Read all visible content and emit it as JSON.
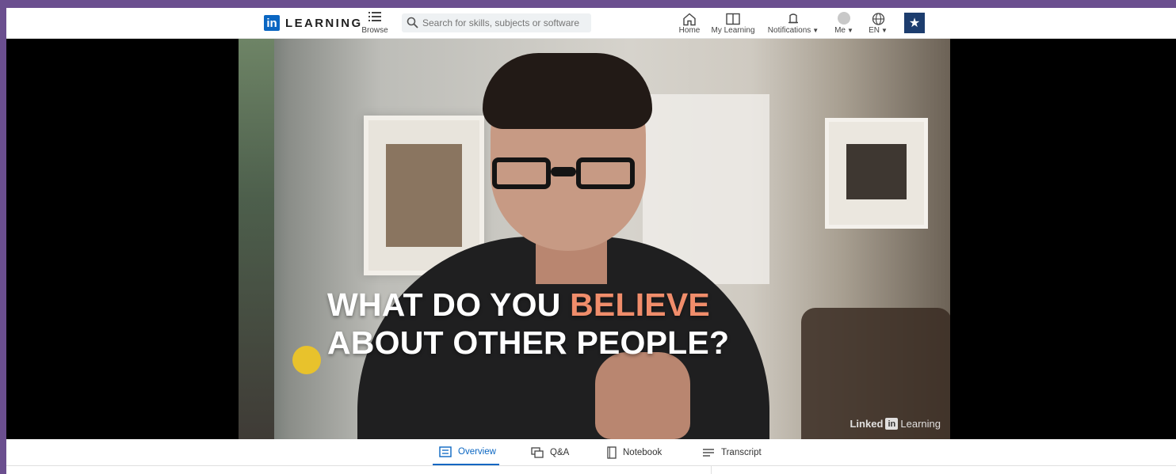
{
  "header": {
    "logo_badge": "in",
    "logo_text": "LEARNING",
    "browse_label": "Browse",
    "search_placeholder": "Search for skills, subjects or software",
    "nav": {
      "home": "Home",
      "my_learning": "My Learning",
      "notifications": "Notifications",
      "me": "Me",
      "language": "EN"
    }
  },
  "video": {
    "caption_line1_prefix": "WHAT DO YOU",
    "caption_line1_highlight": "BELIEVE",
    "caption_line2": "ABOUT OTHER PEOPLE?",
    "watermark_left": "Linked",
    "watermark_badge": "in",
    "watermark_right": "Learning"
  },
  "tabs": [
    {
      "label": "Overview",
      "active": true
    },
    {
      "label": "Q&A",
      "active": false
    },
    {
      "label": "Notebook",
      "active": false
    },
    {
      "label": "Transcript",
      "active": false
    }
  ],
  "colors": {
    "accent": "#0a66c2",
    "highlight": "#f08d6b",
    "frame": "#6b4f8f"
  }
}
